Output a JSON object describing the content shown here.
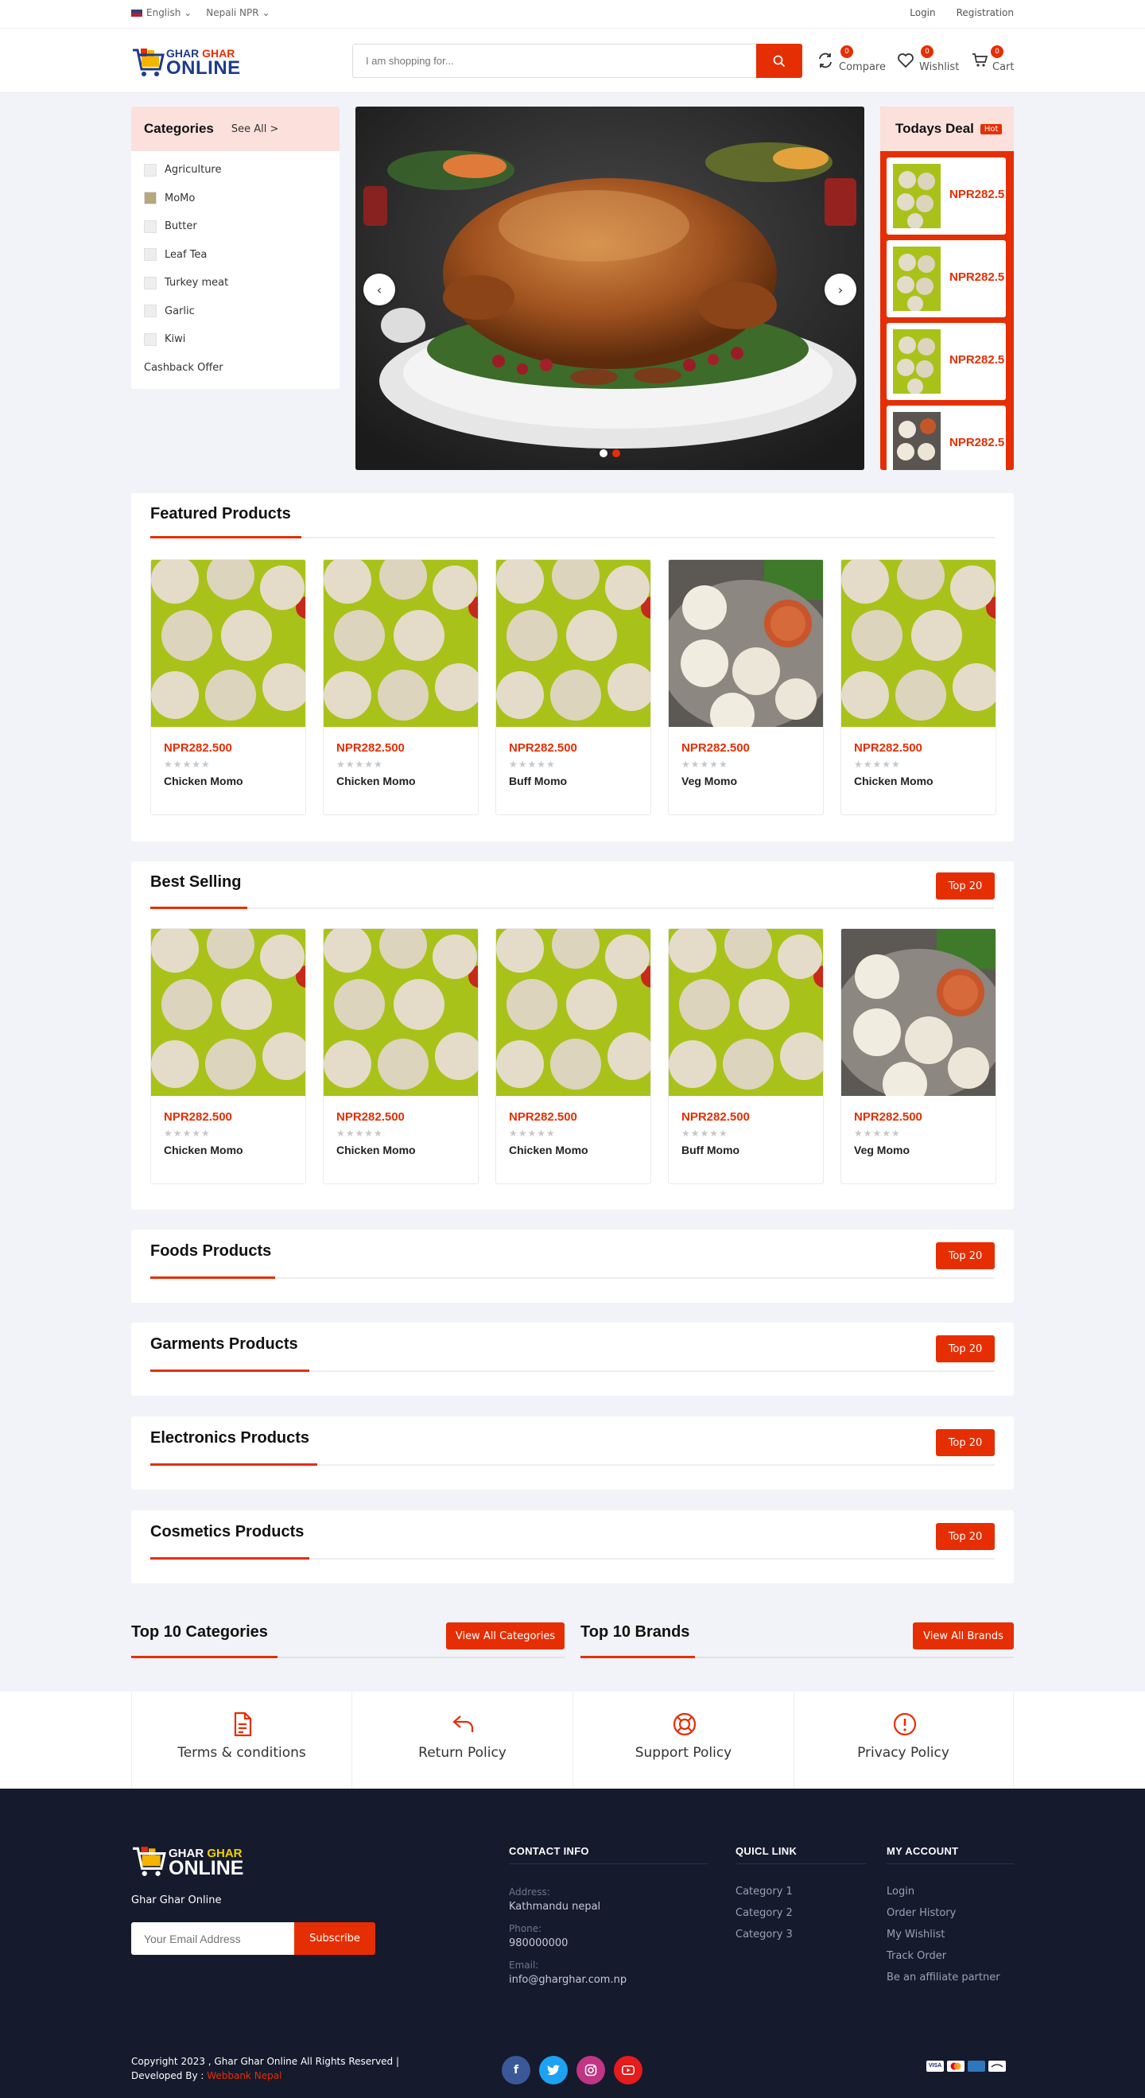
{
  "topbar": {
    "language": "English",
    "currency": "Nepali NPR",
    "login": "Login",
    "registration": "Registration"
  },
  "header": {
    "logo_line1_a": "GHAR",
    "logo_line1_b": "GHAR",
    "logo_line2": "ONLINE",
    "search_placeholder": "I am shopping for...",
    "compare": {
      "label": "Compare",
      "count": "0"
    },
    "wishlist": {
      "label": "Wishlist",
      "count": "0"
    },
    "cart": {
      "label": "Cart",
      "count": "0"
    }
  },
  "categories": {
    "title": "Categories",
    "see_all": "See All >",
    "items": [
      "Agriculture",
      "MoMo",
      "Butter",
      "Leaf Tea",
      "Turkey meat",
      "Garlic",
      "Kiwi"
    ],
    "extra": "Cashback Offer"
  },
  "todays_deal": {
    "title": "Todays Deal",
    "badge": "Hot",
    "prices": [
      "NPR282.5",
      "NPR282.5",
      "NPR282.5",
      "NPR282.5"
    ]
  },
  "featured": {
    "title": "Featured Products",
    "products": [
      {
        "price": "NPR282.500",
        "name": "Chicken Momo",
        "rating": "★★★★★"
      },
      {
        "price": "NPR282.500",
        "name": "Chicken Momo",
        "rating": "★★★★★"
      },
      {
        "price": "NPR282.500",
        "name": "Buff Momo",
        "rating": "★★★★★"
      },
      {
        "price": "NPR282.500",
        "name": "Veg Momo",
        "rating": "★★★★★"
      },
      {
        "price": "NPR282.500",
        "name": "Chicken Momo",
        "rating": "★★★★★"
      }
    ]
  },
  "best_selling": {
    "title": "Best Selling",
    "button": "Top 20",
    "products": [
      {
        "price": "NPR282.500",
        "name": "Chicken Momo",
        "rating": "★★★★★"
      },
      {
        "price": "NPR282.500",
        "name": "Chicken Momo",
        "rating": "★★★★★"
      },
      {
        "price": "NPR282.500",
        "name": "Chicken Momo",
        "rating": "★★★★★"
      },
      {
        "price": "NPR282.500",
        "name": "Buff Momo",
        "rating": "★★★★★"
      },
      {
        "price": "NPR282.500",
        "name": "Veg Momo",
        "rating": "★★★★★"
      }
    ]
  },
  "category_sections": [
    {
      "title": "Foods Products",
      "button": "Top 20"
    },
    {
      "title": "Garments Products",
      "button": "Top 20"
    },
    {
      "title": "Electronics Products",
      "button": "Top 20"
    },
    {
      "title": "Cosmetics Products",
      "button": "Top 20"
    }
  ],
  "top_categories": {
    "title": "Top 10 Categories",
    "button": "View All Categories"
  },
  "top_brands": {
    "title": "Top 10 Brands",
    "button": "View All Brands"
  },
  "policies": [
    "Terms & conditions",
    "Return Policy",
    "Support Policy",
    "Privacy Policy"
  ],
  "footer": {
    "site_name": "Ghar Ghar Online",
    "email_placeholder": "Your Email Address",
    "subscribe": "Subscribe",
    "contact": {
      "title": "CONTACT INFO",
      "address_label": "Address:",
      "address": "Kathmandu nepal",
      "phone_label": "Phone:",
      "phone": "980000000",
      "email_label": "Email:",
      "email": "info@gharghar.com.np"
    },
    "quick_link": {
      "title": "QUICL LINK",
      "items": [
        "Category 1",
        "Category 2",
        "Category 3"
      ]
    },
    "my_account": {
      "title": "MY ACCOUNT",
      "items": [
        "Login",
        "Order History",
        "My Wishlist",
        "Track Order",
        "Be an affiliate partner"
      ]
    },
    "copyright": "Copyright 2023 , Ghar Ghar Online All Rights Reserved |",
    "developed_by": "Developed By :",
    "developer": "Webbank Nepal"
  },
  "colors": {
    "accent": "#e62e04",
    "footer_bg": "#151a2d",
    "category_header": "#fce0dc"
  }
}
